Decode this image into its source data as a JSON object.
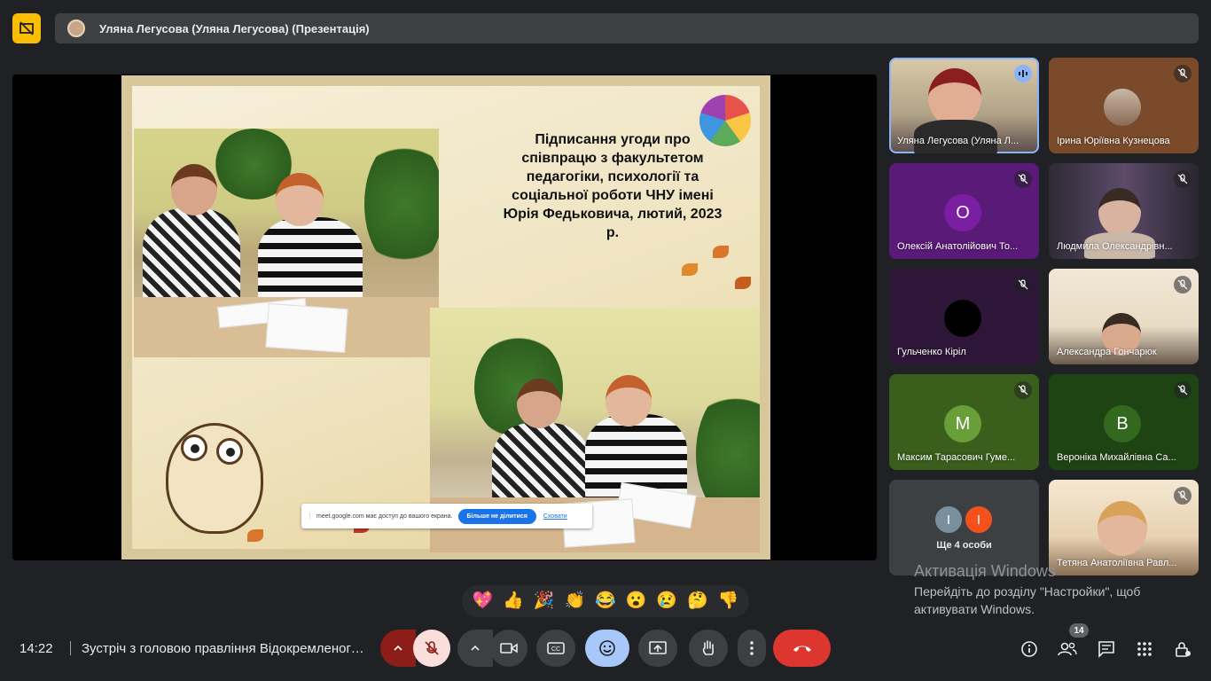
{
  "top_bar": {
    "presenter_title": "Уляна Легусова (Уляна Легусова) (Презентація)"
  },
  "slide": {
    "title": "Підписання угоди про співпрацю з факультетом педагогіки, психології та соціальної роботи ЧНУ імені Юрія Федьковича, лютий, 2023 р."
  },
  "share_notice": {
    "text": "meet.google.com має доступ до вашого екрана.",
    "stop_button": "Більше не ділитися",
    "hide_link": "Сховати"
  },
  "participants": [
    {
      "name": "Уляна Легусова (Уляна Л...",
      "type": "video",
      "mic": "speaking"
    },
    {
      "name": "Ірина Юріївна Кузнецова",
      "type": "avatar-photo",
      "mic": "muted"
    },
    {
      "name": "Олексій Анатолійович То...",
      "type": "initial",
      "initial": "О",
      "color": "#7b1fa2",
      "mic": "muted"
    },
    {
      "name": "Людмила Олександрівн...",
      "type": "video",
      "mic": "muted"
    },
    {
      "name": "Гульченко Кіріл",
      "type": "avatar-dark",
      "mic": "muted"
    },
    {
      "name": "Александра Гончарюк",
      "type": "video",
      "mic": "muted"
    },
    {
      "name": "Максим Тарасович Гуме...",
      "type": "initial",
      "initial": "М",
      "color": "#689f38",
      "mic": "muted"
    },
    {
      "name": "Вероніка Михайлівна Са...",
      "type": "initial",
      "initial": "В",
      "color": "#33691e",
      "mic": "muted"
    },
    {
      "name": "Тетяна Анатоліївна Равл...",
      "type": "video",
      "mic": "muted"
    }
  ],
  "others": {
    "label": "Ще 4 особи",
    "avatars": [
      {
        "initial": "І",
        "color": "#78909c"
      },
      {
        "initial": "І",
        "color": "#f4511e"
      }
    ]
  },
  "watermark": {
    "line1": "Активація Windows",
    "line2": "Перейдіть до розділу \"Настройки\", щоб активувати Windows."
  },
  "reactions": [
    "💖",
    "👍",
    "🎉",
    "👏",
    "😂",
    "😮",
    "😢",
    "🤔",
    "👎"
  ],
  "bottom_bar": {
    "time": "14:22",
    "meeting_title": "Зустріч з головою правління Відокремленого ...",
    "people_count": "14"
  },
  "colors": {
    "background": "#202124",
    "accent_blue": "#8ab4f8",
    "danger_red": "#ea4335",
    "mic_muted_bg": "#8c1d18"
  }
}
